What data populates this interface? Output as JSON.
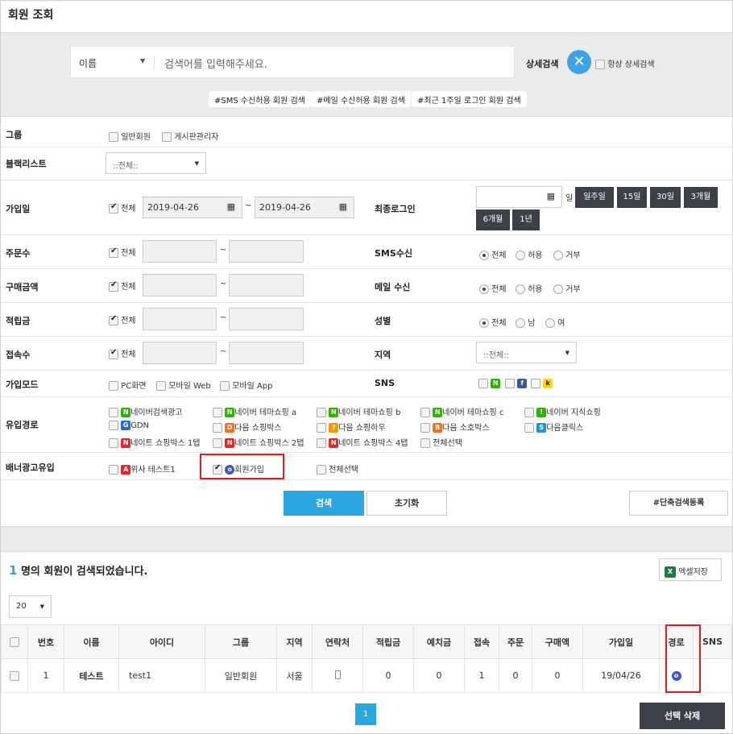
{
  "title": "회원 조회",
  "search": {
    "select_label": "이름",
    "placeholder": "검색어를 입력해주세요.",
    "adv_label": "상세검색",
    "always_adv": "항상 상세검색",
    "pills": [
      "#SMS 수신허용 회원 검색",
      "#메일 수신허용 회원 검색",
      "#최근 1주일 로그인 회원 검색"
    ]
  },
  "filters": {
    "group": {
      "label": "그룹",
      "options": [
        "일반회원",
        "게시판관리자"
      ]
    },
    "blacklist": {
      "label": "블랙리스트",
      "value": "::전체::"
    },
    "join_date": {
      "label": "가입일",
      "all": "전체",
      "from": "2019-04-26",
      "tilde": "~",
      "to": "2019-04-26"
    },
    "last_login": {
      "label": "최종로그인",
      "day_suffix": "일",
      "buttons": [
        "일주일",
        "15일",
        "30일",
        "3개월",
        "6개월",
        "1년"
      ]
    },
    "orders": {
      "label": "주문수",
      "all": "전체",
      "tilde": "~"
    },
    "sms": {
      "label": "SMS수신",
      "options": [
        "전체",
        "허용",
        "거부"
      ]
    },
    "purchase": {
      "label": "구매금액",
      "all": "전체",
      "tilde": "~"
    },
    "mail": {
      "label": "메일 수신",
      "options": [
        "전체",
        "허용",
        "거부"
      ]
    },
    "points": {
      "label": "적립금",
      "all": "전체",
      "tilde": "~"
    },
    "gender": {
      "label": "성별",
      "options": [
        "전체",
        "남",
        "여"
      ]
    },
    "visits": {
      "label": "접속수",
      "all": "전체",
      "tilde": "~"
    },
    "region": {
      "label": "지역",
      "value": "::전체::"
    },
    "join_mode": {
      "label": "가입모드",
      "options": [
        "PC화면",
        "모바일 Web",
        "모바일 App"
      ]
    },
    "sns": {
      "label": "SNS",
      "icons": [
        "N",
        "f",
        "k"
      ]
    },
    "inflow": {
      "label": "유입경로",
      "row1": [
        "네이버검색광고",
        "네이버 테마쇼핑 a",
        "네이버 테마쇼핑 b",
        "네이버 테마쇼핑 c",
        "네이버 지식쇼핑"
      ],
      "row2": [
        "GDN",
        "다음 쇼핑박스",
        "다음 쇼핑하우",
        "다음 소호박스",
        "다음클릭스"
      ],
      "row3": [
        "네이트 쇼핑박스 1탭",
        "네이트 쇼핑박스 2탭",
        "네이트 쇼핑박스 4탭",
        "전체선택"
      ],
      "icons1": [
        "N",
        "N",
        "N",
        "N",
        "!"
      ],
      "icons2": [
        "G",
        "D",
        "?",
        "B",
        "S"
      ],
      "icons3": [
        "N",
        "N",
        "N"
      ]
    },
    "banner": {
      "label": "배너광고유입",
      "options": [
        "위사 테스트1",
        "회원가입",
        "전체선택"
      ],
      "icons": [
        "A",
        "o"
      ]
    }
  },
  "actions": {
    "search": "검색",
    "reset": "초기화",
    "shortcut": "#단축검색등록"
  },
  "results": {
    "count": "1",
    "count_text": "명의 회원이 검색되었습니다.",
    "excel": "엑셀저장",
    "page_size": "20",
    "excel_icon": "X"
  },
  "table": {
    "headers": [
      "번호",
      "이름",
      "아이디",
      "그룹",
      "지역",
      "연락처",
      "적립금",
      "예치금",
      "접속",
      "주문",
      "구매액",
      "가입일",
      "경로",
      "SNS"
    ],
    "row": {
      "no": "1",
      "name": "테스트",
      "id": "test1",
      "group": "일반회원",
      "region": "서울",
      "phone_icon": "phone-icon",
      "points": "0",
      "deposit": "0",
      "visits": "1",
      "orders": "0",
      "purchase": "0",
      "joined": "19/04/26",
      "route_icon": "o"
    }
  },
  "pagination": {
    "current": "1"
  },
  "delete_label": "선택 삭제",
  "colors": {
    "accent": "#2aa6e0",
    "dark": "#3c4148",
    "highlight": "#e01b1b",
    "naver": "#2db400",
    "daum": "#f36f21",
    "nate": "#e8262a"
  }
}
